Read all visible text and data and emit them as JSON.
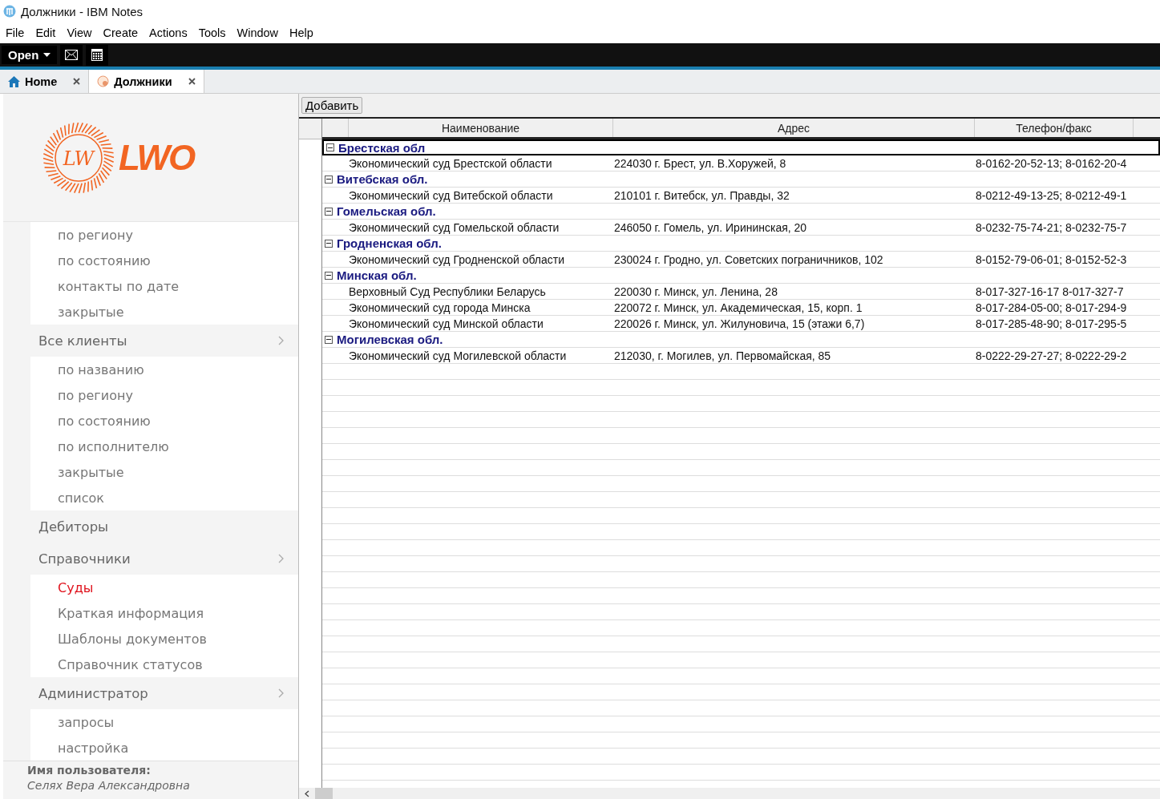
{
  "window": {
    "title": "Должники - IBM Notes"
  },
  "menu": [
    "File",
    "Edit",
    "View",
    "Create",
    "Actions",
    "Tools",
    "Window",
    "Help"
  ],
  "toolbar": {
    "open_label": "Open"
  },
  "tabs": [
    {
      "label": "Home",
      "kind": "home",
      "selected": false
    },
    {
      "label": "Должники",
      "kind": "db",
      "selected": true
    }
  ],
  "sidebar": {
    "logo": {
      "monogram": "LW",
      "text": "LWO"
    },
    "sections": [
      {
        "children": [
          {
            "label": "по региону",
            "selected": false
          },
          {
            "label": "по состоянию",
            "selected": false
          },
          {
            "label": "контакты по дате",
            "selected": false
          },
          {
            "label": "закрытые",
            "selected": false
          }
        ]
      },
      {
        "label": "Все клиенты",
        "expandable": true,
        "children": [
          {
            "label": "по названию",
            "selected": false
          },
          {
            "label": "по региону",
            "selected": false
          },
          {
            "label": "по состоянию",
            "selected": false
          },
          {
            "label": "по исполнителю",
            "selected": false
          },
          {
            "label": "закрытые",
            "selected": false
          },
          {
            "label": "список",
            "selected": false
          }
        ]
      },
      {
        "label": "Дебиторы",
        "expandable": false
      },
      {
        "label": "Справочники",
        "expandable": true,
        "children": [
          {
            "label": "Суды",
            "selected": true
          },
          {
            "label": "Краткая информация",
            "selected": false
          },
          {
            "label": "Шаблоны документов",
            "selected": false
          },
          {
            "label": "Справочник статусов",
            "selected": false
          }
        ]
      },
      {
        "label": "Администратор",
        "expandable": true,
        "children": [
          {
            "label": "запросы",
            "selected": false
          },
          {
            "label": "настройка",
            "selected": false
          }
        ]
      }
    ],
    "user_label": "Имя пользователя:",
    "user_name": "Селях Вера Александровна"
  },
  "action_button": "Добавить",
  "table": {
    "columns": [
      "Наименование",
      "Адрес",
      "Телефон/факс"
    ],
    "groups": [
      {
        "label": "Брестская обл",
        "expanded": true,
        "selected": true,
        "rows": [
          [
            "Экономический суд Брестской области",
            "224030 г. Брест, ул. В.Хоружей, 8",
            "8-0162-20-52-13; 8-0162-20-4"
          ]
        ]
      },
      {
        "label": "Витебская обл.",
        "expanded": true,
        "selected": false,
        "rows": [
          [
            "Экономический суд Витебской области",
            "210101 г. Витебск, ул. Правды, 32",
            "8-0212-49-13-25; 8-0212-49-1"
          ]
        ]
      },
      {
        "label": "Гомельская обл.",
        "expanded": true,
        "selected": false,
        "rows": [
          [
            "Экономический суд Гомельской области",
            "246050 г. Гомель, ул. Ирининская, 20",
            "8-0232-75-74-21; 8-0232-75-7"
          ]
        ]
      },
      {
        "label": "Гродненская обл.",
        "expanded": true,
        "selected": false,
        "rows": [
          [
            "Экономический суд Гродненской области",
            "230024 г. Гродно, ул. Советских пограничников, 102",
            "8-0152-79-06-01; 8-0152-52-3"
          ]
        ]
      },
      {
        "label": "Минская обл.",
        "expanded": true,
        "selected": false,
        "rows": [
          [
            "Верховный Суд Республики Беларусь",
            "220030 г. Минск, ул. Ленина, 28",
            "8-017-327-16-17 8-017-327-7"
          ],
          [
            "Экономический суд города Минска",
            "220072 г. Минск, ул. Академическая, 15, корп. 1",
            "8-017-284-05-00; 8-017-294-9"
          ],
          [
            "Экономический суд Минской области",
            "220026 г. Минск, ул. Жилуновича, 15 (этажи 6,7)",
            "8-017-285-48-90; 8-017-295-5"
          ]
        ]
      },
      {
        "label": "Могилевская обл.",
        "expanded": true,
        "selected": false,
        "rows": [
          [
            "Экономический суд Могилевской области",
            "212030, г. Могилев, ул. Первомайская, 85",
            "8-0222-29-27-27; 8-0222-29-2"
          ]
        ]
      }
    ]
  }
}
